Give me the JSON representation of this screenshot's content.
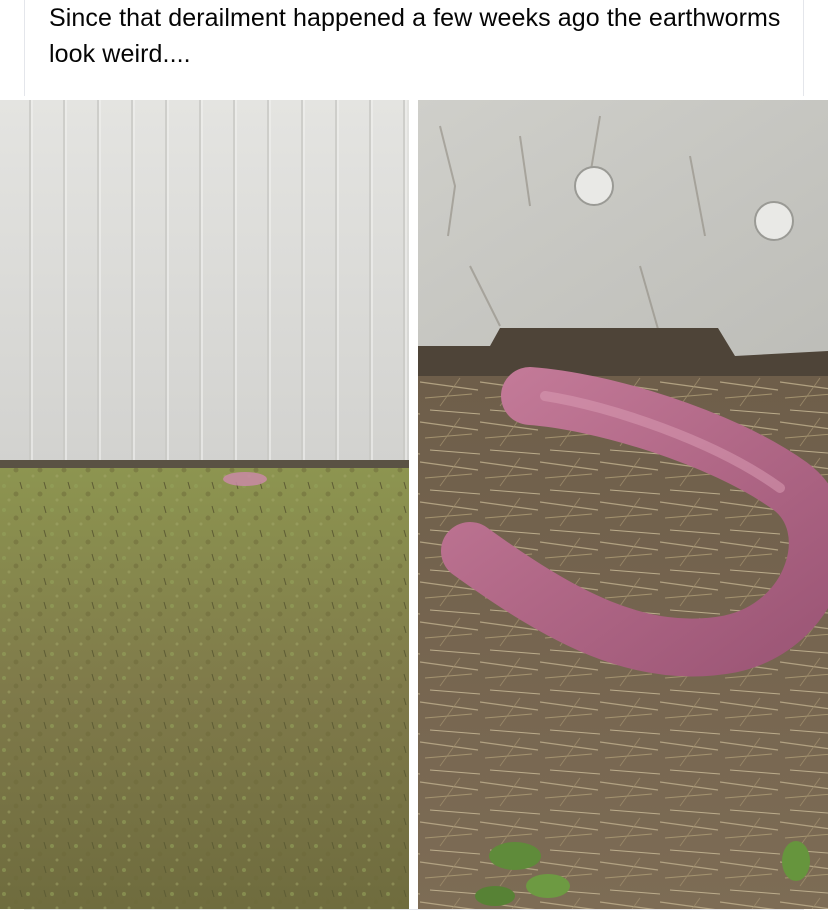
{
  "post": {
    "caption": "Since that derailment happened a few weeks ago the earthworms look weird....",
    "colors": {
      "text": "#050505",
      "divider": "#e4e6eb",
      "wall": "#d8d8d4",
      "grass": "#8b8b4a",
      "dry_grass": "#9a8a6e",
      "pink_object": "#b46a88"
    },
    "media": {
      "left_photo": {
        "subject": "metal-wall-and-lawn"
      },
      "right_photo": {
        "subject": "pink-object-on-straw"
      }
    }
  }
}
